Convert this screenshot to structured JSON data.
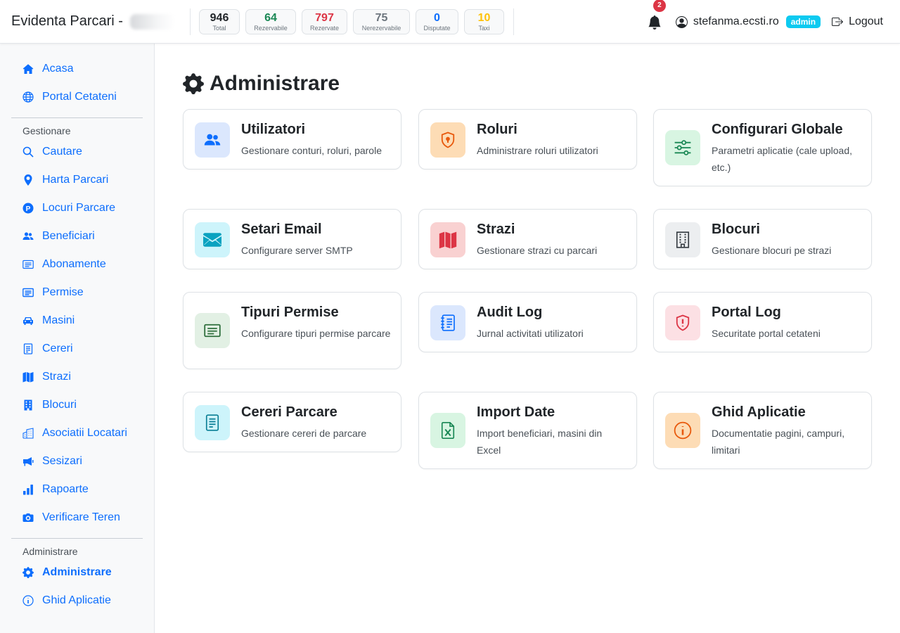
{
  "header": {
    "app_title": "Evidenta Parcari - ",
    "stats": [
      {
        "value": "946",
        "label": "Total",
        "color": "#212529"
      },
      {
        "value": "64",
        "label": "Rezervabile",
        "color": "#198754"
      },
      {
        "value": "797",
        "label": "Rezervate",
        "color": "#dc3545"
      },
      {
        "value": "75",
        "label": "Nerezervabile",
        "color": "#6c757d"
      },
      {
        "value": "0",
        "label": "Disputate",
        "color": "#0d6efd"
      },
      {
        "value": "10",
        "label": "Taxi",
        "color": "#ffc107"
      }
    ],
    "notifications_count": "2",
    "user_email": "stefanma.ecsti.ro",
    "role_badge": "admin",
    "logout_label": "Logout"
  },
  "sidebar": {
    "top_items": [
      {
        "label": "Acasa",
        "icon": "home-icon"
      },
      {
        "label": "Portal Cetateni",
        "icon": "globe-icon"
      }
    ],
    "section_gestionare": "Gestionare",
    "gestionare_items": [
      {
        "label": "Cautare",
        "icon": "search-icon"
      },
      {
        "label": "Harta Parcari",
        "icon": "map-pin-icon"
      },
      {
        "label": "Locuri Parcare",
        "icon": "parking-icon"
      },
      {
        "label": "Beneficiari",
        "icon": "people-icon"
      },
      {
        "label": "Abonamente",
        "icon": "card-icon"
      },
      {
        "label": "Permise",
        "icon": "permit-icon"
      },
      {
        "label": "Masini",
        "icon": "car-icon"
      },
      {
        "label": "Cereri",
        "icon": "document-icon"
      },
      {
        "label": "Strazi",
        "icon": "map-icon"
      },
      {
        "label": "Blocuri",
        "icon": "building-icon"
      },
      {
        "label": "Asociatii Locatari",
        "icon": "buildings-icon"
      },
      {
        "label": "Sesizari",
        "icon": "megaphone-icon"
      },
      {
        "label": "Rapoarte",
        "icon": "bar-chart-icon"
      },
      {
        "label": "Verificare Teren",
        "icon": "camera-icon"
      }
    ],
    "section_administrare": "Administrare",
    "admin_items": [
      {
        "label": "Administrare",
        "icon": "gear-icon",
        "active": true
      },
      {
        "label": "Ghid Aplicatie",
        "icon": "info-icon"
      }
    ]
  },
  "main": {
    "page_title": "Administrare",
    "cards": [
      {
        "title": "Utilizatori",
        "desc": "Gestionare conturi, roluri, parole",
        "icon": "users-icon",
        "bg": "#dbe7fd",
        "fg": "#0d6efd"
      },
      {
        "title": "Roluri",
        "desc": "Administrare roluri utilizatori",
        "icon": "shield-lock-icon",
        "bg": "#fddcb5",
        "fg": "#e8590c"
      },
      {
        "title": "Configurari Globale",
        "desc": "Parametri aplicatie (cale upload, etc.)",
        "icon": "sliders-icon",
        "bg": "#d8f5e2",
        "fg": "#198754"
      },
      {
        "title": "Setari Email",
        "desc": "Configurare server SMTP",
        "icon": "envelope-icon",
        "bg": "#cdf4fb",
        "fg": "#0aa2c0"
      },
      {
        "title": "Strazi",
        "desc": "Gestionare strazi cu parcari",
        "icon": "map-icon",
        "bg": "#f9d1d1",
        "fg": "#dc3545"
      },
      {
        "title": "Blocuri",
        "desc": "Gestionare blocuri pe strazi",
        "icon": "building-icon",
        "bg": "#eceef0",
        "fg": "#343a40"
      },
      {
        "title": "Tipuri Permise",
        "desc": "Configurare tipuri permise parcare",
        "icon": "card-text-icon",
        "bg": "#e2f0e4",
        "fg": "#2f6f3d"
      },
      {
        "title": "Audit Log",
        "desc": "Jurnal activitati utilizatori",
        "icon": "journal-icon",
        "bg": "#dbe7fd",
        "fg": "#0d6efd"
      },
      {
        "title": "Portal Log",
        "desc": "Securitate portal cetateni",
        "icon": "shield-alert-icon",
        "bg": "#fce0e4",
        "fg": "#dc3545"
      },
      {
        "title": "Cereri Parcare",
        "desc": "Gestionare cereri de parcare",
        "icon": "file-text-icon",
        "bg": "#cdf4fb",
        "fg": "#0aa2c0"
      },
      {
        "title": "Import Date",
        "desc": "Import beneficiari, masini din Excel",
        "icon": "file-excel-icon",
        "bg": "#d8f5e2",
        "fg": "#198754"
      },
      {
        "title": "Ghid Aplicatie",
        "desc": "Documentatie pagini, campuri, limitari",
        "icon": "info-icon",
        "bg": "#fddcb5",
        "fg": "#e8590c"
      }
    ]
  }
}
